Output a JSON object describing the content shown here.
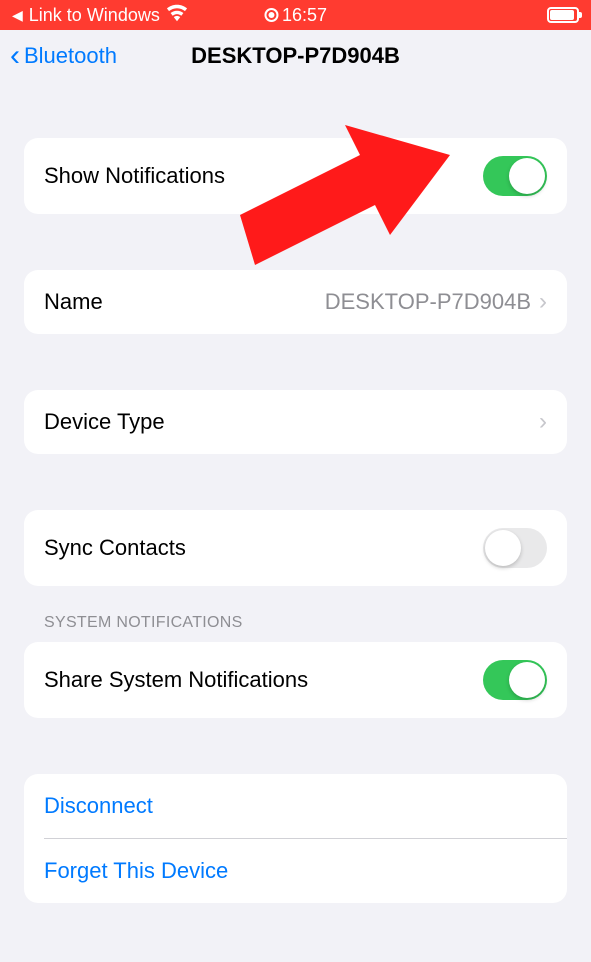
{
  "statusBar": {
    "appReturn": "Link to Windows",
    "time": "16:57"
  },
  "nav": {
    "backLabel": "Bluetooth",
    "title": "DESKTOP-P7D904B"
  },
  "cells": {
    "showNotifications": {
      "label": "Show Notifications",
      "on": true
    },
    "name": {
      "label": "Name",
      "value": "DESKTOP-P7D904B"
    },
    "deviceType": {
      "label": "Device Type"
    },
    "syncContacts": {
      "label": "Sync Contacts",
      "on": false
    },
    "systemNotificationsHeader": "SYSTEM NOTIFICATIONS",
    "shareSystemNotifications": {
      "label": "Share System Notifications",
      "on": true
    },
    "disconnect": "Disconnect",
    "forget": "Forget This Device"
  }
}
